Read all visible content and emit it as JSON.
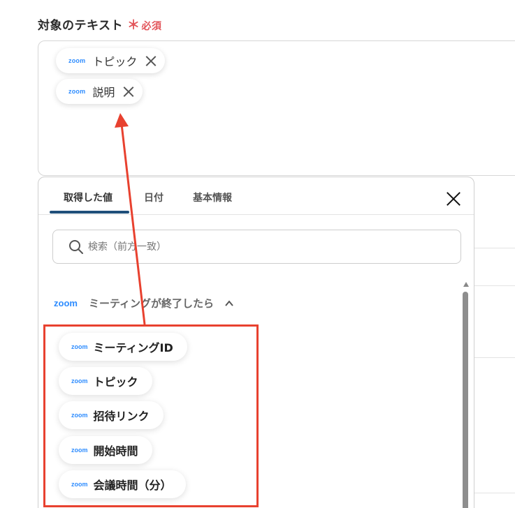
{
  "field": {
    "label": "対象のテキスト",
    "asterisk": "＊",
    "required": "必須"
  },
  "selected_chips": [
    {
      "source": "zoom",
      "label": "トピック"
    },
    {
      "source": "zoom",
      "label": "説明"
    }
  ],
  "panel": {
    "tabs": [
      {
        "label": "取得した値",
        "active": true
      },
      {
        "label": "日付",
        "active": false
      },
      {
        "label": "基本情報",
        "active": false
      }
    ],
    "search": {
      "placeholder": "検索（前方一致）",
      "value": ""
    },
    "section": {
      "source": "zoom",
      "title": "ミーティングが終了したら",
      "expanded": true
    },
    "items": [
      {
        "source": "zoom",
        "label": "ミーティングID"
      },
      {
        "source": "zoom",
        "label": "トピック"
      },
      {
        "source": "zoom",
        "label": "招待リンク"
      },
      {
        "source": "zoom",
        "label": "開始時間"
      },
      {
        "source": "zoom",
        "label": "会議時間（分）"
      }
    ]
  },
  "icons": {
    "chip_remove": "close-icon",
    "panel_close": "close-icon",
    "search": "search-icon",
    "collapse": "chevron-up-icon",
    "source_logo": "zoom-logo"
  },
  "colors": {
    "required": "#e2555a",
    "zoom_blue": "#2d8cff",
    "tab_active_underline": "#1f4f7a",
    "annotation_red": "#e8412f"
  }
}
